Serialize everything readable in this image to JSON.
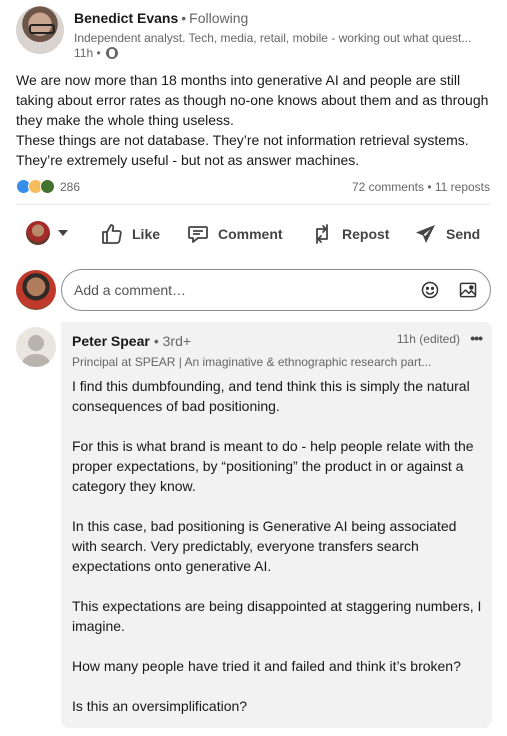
{
  "post": {
    "author": {
      "name": "Benedict Evans",
      "separator": "•",
      "follow_state": "Following",
      "headline": "Independent analyst. Tech, media, retail, mobile - working out what quest...",
      "time": "11h •"
    },
    "body": [
      "We are now more than 18 months into generative AI and people are still taking about error rates as though no-one knows about them and as through they make the whole thing useless.",
      "These things are not database. They’re not information retrieval systems. They’re extremely useful - but not as answer machines."
    ],
    "reaction_count": "286",
    "comments_reposts": "72 comments • 11 reposts",
    "reaction_icons": [
      "like-reaction-icon",
      "insightful-reaction-icon",
      "celebrate-reaction-icon"
    ]
  },
  "actions": {
    "like": "Like",
    "comment": "Comment",
    "repost": "Repost",
    "send": "Send"
  },
  "comment_box": {
    "placeholder": "Add a comment…"
  },
  "comment": {
    "name": "Peter Spear",
    "degree": "• 3rd+",
    "time": "11h (edited)",
    "more": "•••",
    "headline": "Principal at SPEAR | An imaginative & ethnographic research part...",
    "paragraphs": [
      "I find this dumbfounding, and tend think this is simply the natural consequences of bad positioning.",
      "For this is what brand is meant to do - help people relate with the proper expectations, by “positioning” the product in or against a category they know.",
      "In this case, bad positioning is Generative AI being associated with search. Very predictably, everyone transfers search expectations onto generative AI.",
      "This expectations are being disappointed at staggering numbers, I imagine.",
      "How many people have tried it and failed and think it’s broken?",
      "Is this an oversimplification?"
    ]
  },
  "colors": {
    "text": "#191919",
    "muted": "#666666",
    "comment_bg": "#f2f2f2",
    "like_blue": "#378fe9"
  }
}
